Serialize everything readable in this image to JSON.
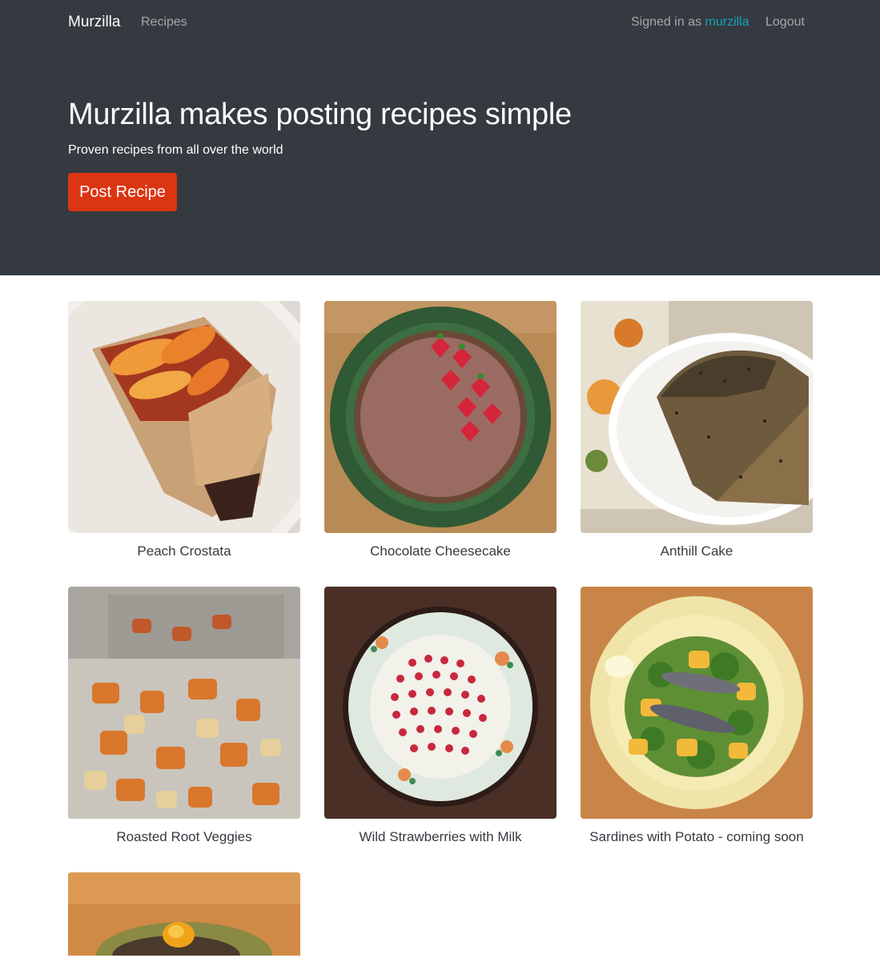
{
  "navbar": {
    "brand": "Murzilla",
    "recipes_link": "Recipes",
    "signed_in_prefix": "Signed in as ",
    "username": "murzilla",
    "logout": "Logout"
  },
  "hero": {
    "title": "Murzilla makes posting recipes simple",
    "subtitle": "Proven recipes from all over the world",
    "button": "Post Recipe"
  },
  "recipes": [
    {
      "title": "Peach Crostata"
    },
    {
      "title": "Chocolate Cheesecake"
    },
    {
      "title": "Anthill Cake"
    },
    {
      "title": "Roasted Root Veggies"
    },
    {
      "title": "Wild Strawberries with Milk"
    },
    {
      "title": "Sardines with Potato - coming soon"
    },
    {
      "title": ""
    }
  ],
  "colors": {
    "navbar_bg": "#343a40",
    "accent_user": "#17a2b8",
    "button_bg": "#dc3512"
  }
}
